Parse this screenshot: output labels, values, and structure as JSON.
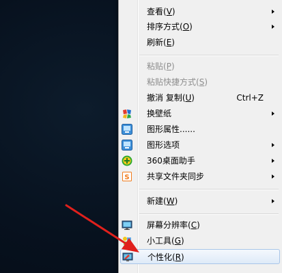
{
  "menu": {
    "view": {
      "text": "查看(",
      "key": "V",
      "close": ")"
    },
    "sort": {
      "text": "排序方式(",
      "key": "O",
      "close": ")"
    },
    "refresh": {
      "text": "刷新(",
      "key": "E",
      "close": ")"
    },
    "paste": {
      "text": "粘贴(",
      "key": "P",
      "close": ")"
    },
    "paste_shortcut": {
      "text": "粘贴快捷方式(",
      "key": "S",
      "close": ")"
    },
    "undo_copy": {
      "text": "撤消 复制(",
      "key": "U",
      "close": ")",
      "shortcut": "Ctrl+Z"
    },
    "change_wallpaper": {
      "text": "换壁纸"
    },
    "graphics_properties": {
      "text": "图形属性......"
    },
    "graphics_options": {
      "text": "图形选项"
    },
    "desktop_assistant": {
      "text": "360桌面助手"
    },
    "shared_folder_sync": {
      "text": "共享文件夹同步"
    },
    "new": {
      "text": "新建(",
      "key": "W",
      "close": ")"
    },
    "screen_resolution": {
      "text": "屏幕分辨率(",
      "key": "C",
      "close": ")"
    },
    "gadgets": {
      "text": "小工具(",
      "key": "G",
      "close": ")"
    },
    "personalize": {
      "text": "个性化(",
      "key": "R",
      "close": ")"
    }
  },
  "colors": {
    "arrow": "#e0201c",
    "menu_bg": "#f0f0f0",
    "highlight_border": "#a8c5e8"
  },
  "icons": {
    "change_wallpaper": "wallpaper-icon",
    "graphics_properties": "intel-graphics-icon",
    "graphics_options": "intel-graphics-icon",
    "desktop_assistant": "360-plus-icon",
    "shared_folder_sync": "sync-folder-icon",
    "screen_resolution": "monitor-icon",
    "gadgets": "gadgets-icon",
    "personalize": "personalize-monitor-icon"
  }
}
